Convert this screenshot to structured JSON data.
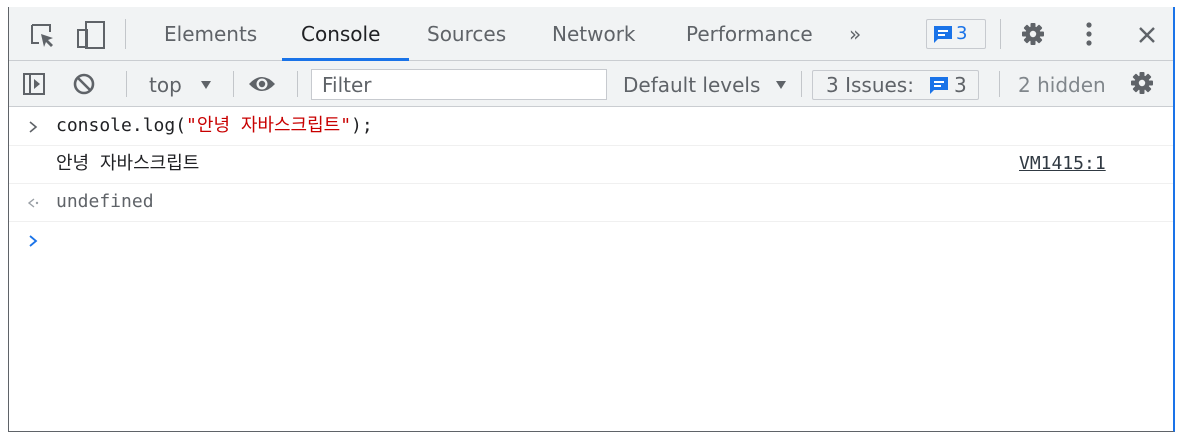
{
  "tabs": [
    {
      "label": "Elements"
    },
    {
      "label": "Console"
    },
    {
      "label": "Sources"
    },
    {
      "label": "Network"
    },
    {
      "label": "Performance"
    }
  ],
  "tabbar": {
    "more_tabs": "»",
    "issues_badge_count": "3"
  },
  "toolbar": {
    "context": "top",
    "filter_placeholder": "Filter",
    "levels": "Default levels",
    "issues_label": "3 Issues:",
    "issues_count": "3",
    "hidden": "2 hidden"
  },
  "console": {
    "input_prefix": "console.log(",
    "input_string": "\"안녕 자바스크립트\"",
    "input_suffix": ");",
    "output": "안녕 자바스크립트",
    "source_link": "VM1415:1",
    "result": "undefined"
  },
  "colors": {
    "accent": "#1a73e8",
    "string": "#c80000",
    "toolbar_bg": "#f1f3f4"
  },
  "icons": [
    "inspect-element-icon",
    "device-toggle-icon",
    "message-icon",
    "settings-gear-icon",
    "kebab-menu-icon",
    "close-icon",
    "sidebar-toggle-icon",
    "clear-console-icon",
    "eye-icon",
    "dropdown-arrow-icon",
    "input-prompt-icon",
    "result-arrow-icon"
  ]
}
